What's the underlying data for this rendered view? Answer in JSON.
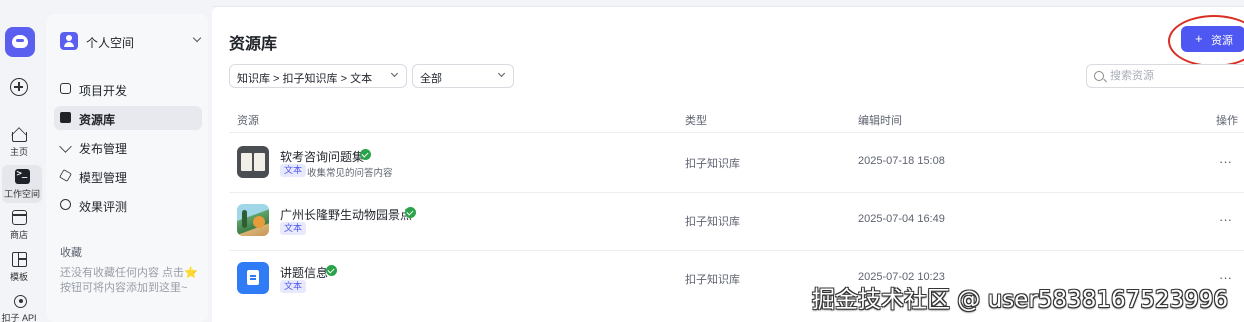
{
  "rail": {
    "items": [
      {
        "label": "主页",
        "icon": "home-icon"
      },
      {
        "label": "工作空间",
        "icon": "terminal-icon"
      },
      {
        "label": "商店",
        "icon": "store-icon"
      },
      {
        "label": "模板",
        "icon": "template-icon"
      },
      {
        "label": "扣子 API",
        "icon": "api-icon"
      }
    ]
  },
  "sidebar": {
    "space_label": "个人空间",
    "nav": [
      {
        "label": "项目开发",
        "icon": "project-icon"
      },
      {
        "label": "资源库",
        "icon": "library-icon"
      },
      {
        "label": "发布管理",
        "icon": "publish-icon"
      },
      {
        "label": "模型管理",
        "icon": "model-icon"
      },
      {
        "label": "效果评测",
        "icon": "evaluate-icon"
      }
    ],
    "favorites_title": "收藏",
    "favorites_empty": "还没有收藏任何内容 点击⭐按钮可将内容添加到这里~"
  },
  "main": {
    "title": "资源库",
    "add_button_plus": "+",
    "add_button_label": "资源",
    "filter_path": "知识库 > 扣子知识库 > 文本",
    "filter_scope": "全部",
    "search_placeholder": "搜索资源",
    "columns": {
      "resource": "资源",
      "type": "类型",
      "edit_time": "编辑时间",
      "actions": "操作"
    },
    "rows": [
      {
        "name": "软考咨询问题集",
        "tag": "文本",
        "desc": "收集常见的问答内容",
        "type": "扣子知识库",
        "time": "2025-07-18 15:08",
        "more": "···"
      },
      {
        "name": "广州长隆野生动物园景点",
        "tag": "文本",
        "desc": "",
        "type": "扣子知识库",
        "time": "2025-07-04 16:49",
        "more": "···"
      },
      {
        "name": "讲题信息",
        "tag": "文本",
        "desc": "",
        "type": "扣子知识库",
        "time": "2025-07-02 10:23",
        "more": "···"
      }
    ]
  },
  "watermark": "掘金技术社区 @ user5838167523996",
  "colors": {
    "accent": "#4e57f1",
    "annotation": "#d93025",
    "verified": "#2aa34a"
  }
}
